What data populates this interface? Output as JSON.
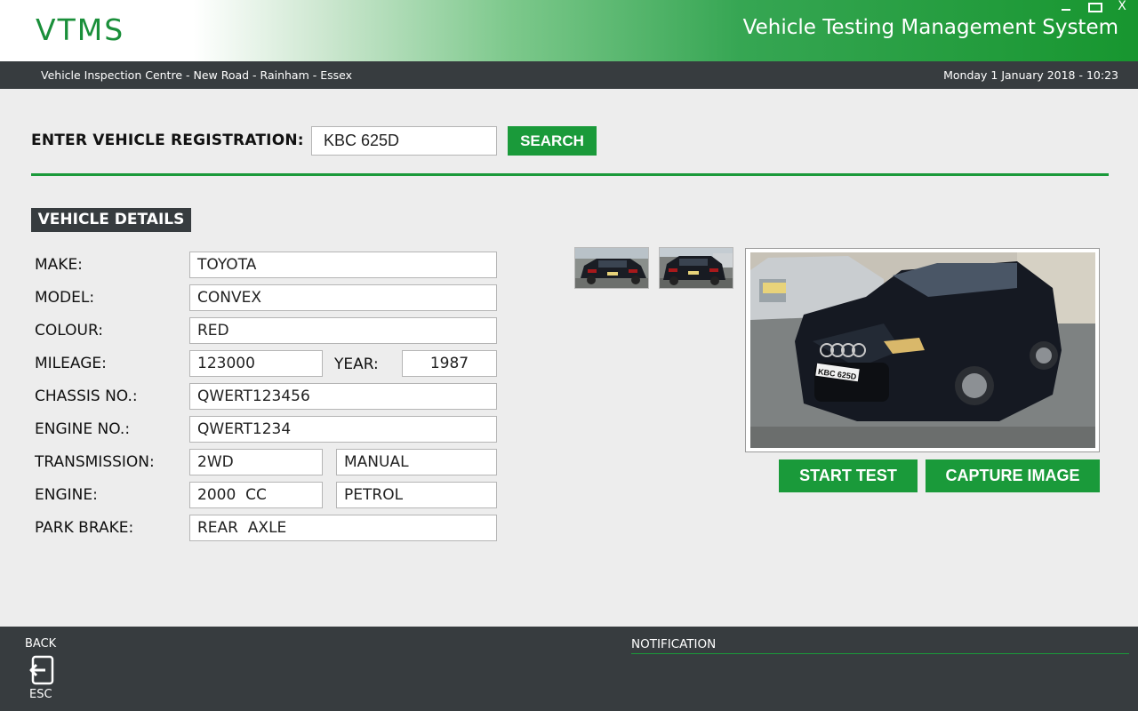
{
  "header": {
    "logo": "VTMS",
    "title": "Vehicle Testing Management System",
    "window_controls": {
      "minimize": "minimize-icon",
      "maximize": "maximize-icon",
      "close": "X"
    }
  },
  "infobar": {
    "location": "Vehicle Inspection Centre - New Road - Rainham - Essex",
    "datetime": "Monday 1 January 2018 - 10:23"
  },
  "search": {
    "label": "ENTER VEHICLE REGISTRATION:",
    "value": "KBC 625D",
    "button": "SEARCH"
  },
  "vehicle_details": {
    "heading": "VEHICLE DETAILS",
    "make_label": "MAKE:",
    "make": "TOYOTA",
    "model_label": "MODEL:",
    "model": "CONVEX",
    "colour_label": "COLOUR:",
    "colour": "RED",
    "mileage_label": "MILEAGE:",
    "mileage": "123000",
    "year_label": "YEAR:",
    "year": "1987",
    "chassis_label": "CHASSIS NO.:",
    "chassis": "QWERT123456",
    "engine_no_label": "ENGINE NO.:",
    "engine_no": "QWERT1234",
    "transmission_label": "TRANSMISSION:",
    "drive": "2WD",
    "gearbox": "MANUAL",
    "engine_label": "ENGINE:",
    "engine_size": "2000  CC",
    "fuel": "PETROL",
    "park_brake_label": "PARK BRAKE:",
    "park_brake": "REAR  AXLE"
  },
  "images": {
    "plate_text": "KBC 625D",
    "start_test": "START TEST",
    "capture_image": "CAPTURE IMAGE"
  },
  "footer": {
    "back": "BACK",
    "esc": "ESC",
    "notification": "NOTIFICATION"
  },
  "colors": {
    "brand_green": "#1a9a3a",
    "dark_bar": "#373c3f",
    "background": "#ededed"
  }
}
